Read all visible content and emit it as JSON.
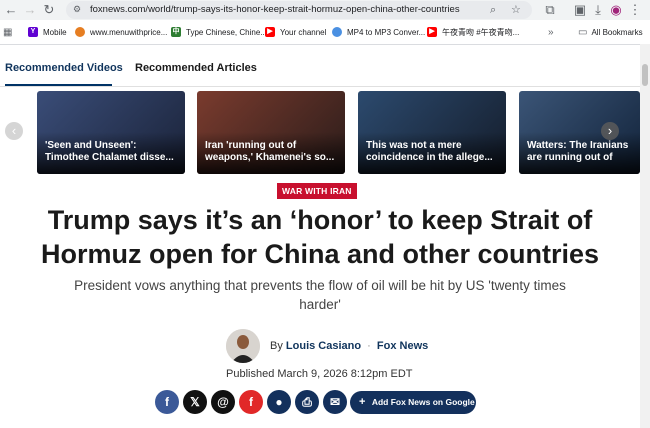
{
  "browser": {
    "url": "foxnews.com/world/trump-says-its-honor-keep-strait-hormuz-open-china-other-countries",
    "bookmarks": [
      {
        "label": "Mobile",
        "icon": "yahoo-icon",
        "color": "#6001d2"
      },
      {
        "label": "www.menuwithprice...",
        "icon": "menu-icon",
        "color": "#e67e22"
      },
      {
        "label": "Type Chinese, Chine...",
        "icon": "chinese-input-icon",
        "color": "#2e7d32"
      },
      {
        "label": "Your channel",
        "icon": "youtube-icon",
        "color": "#ff0000"
      },
      {
        "label": "MP4 to MP3 Conver...",
        "icon": "converter-icon",
        "color": "#4a90e2"
      },
      {
        "label": "午夜青吻 #午夜青吻...",
        "icon": "youtube-icon",
        "color": "#ff0000"
      }
    ],
    "all_bookmarks": "All Bookmarks",
    "overflow": "»"
  },
  "tabs": {
    "videos": "Recommended Videos",
    "articles": "Recommended Articles"
  },
  "videos": [
    {
      "caption": "'Seen and Unseen': Timothee Chalamet disse...",
      "colors": [
        "#3a4d78",
        "#1a2238"
      ]
    },
    {
      "caption": "Iran 'running out of weapons,' Khamenei's so...",
      "colors": [
        "#7a3b2e",
        "#2a1c1a"
      ]
    },
    {
      "caption": "This was not a mere coincidence in the allege...",
      "colors": [
        "#2c4a6e",
        "#141c2a"
      ]
    },
    {
      "caption": "Watters: The Iranians are running out of cards",
      "colors": [
        "#3b5577",
        "#12233a"
      ]
    }
  ],
  "article": {
    "category": "WAR WITH IRAN",
    "headline": "Trump says it’s an ‘honor’ to keep Strait of Hormuz open for China and other countries",
    "subhead": "President vows anything that prevents the flow of oil will be hit by US 'twenty times harder'",
    "by": "By",
    "author": "Louis Casiano",
    "separator": "·",
    "outlet": "Fox News",
    "published": "Published March 9, 2026 8:12pm EDT"
  },
  "share": [
    {
      "icon": "facebook-icon",
      "glyph": "f",
      "color": "#3b5998"
    },
    {
      "icon": "x-icon",
      "glyph": "𝕏",
      "color": "#111111"
    },
    {
      "icon": "threads-icon",
      "glyph": "@",
      "color": "#111111"
    },
    {
      "icon": "flipboard-icon",
      "glyph": "f",
      "color": "#e12828"
    },
    {
      "icon": "comment-icon",
      "glyph": "●",
      "color": "#13305c"
    },
    {
      "icon": "print-icon",
      "glyph": "⎙",
      "color": "#13305c"
    },
    {
      "icon": "email-icon",
      "glyph": "✉",
      "color": "#13305c"
    }
  ],
  "add_button": {
    "label": "Add Fox News on Google",
    "glyph": "+"
  }
}
